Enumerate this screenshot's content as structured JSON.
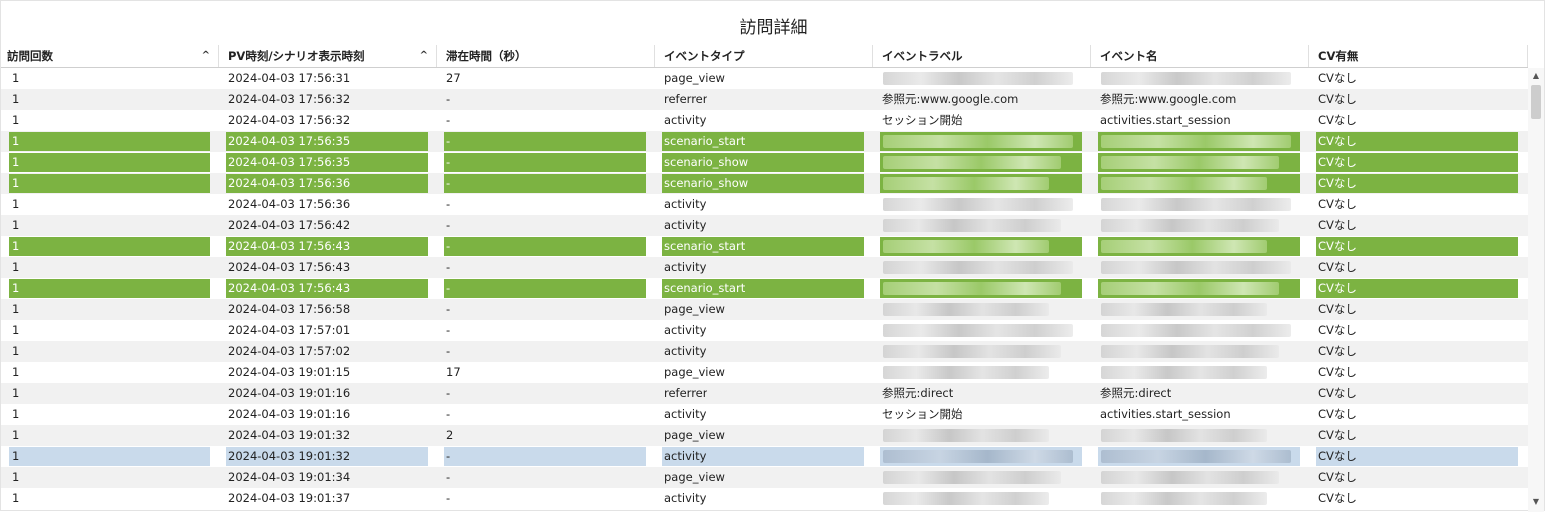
{
  "title": "訪問詳細",
  "columns": [
    {
      "label": "訪問回数",
      "sort": "^"
    },
    {
      "label": "PV時刻/シナリオ表示時刻",
      "sort": "^"
    },
    {
      "label": "滞在時間（秒）",
      "sort": ""
    },
    {
      "label": "イベントタイプ",
      "sort": ""
    },
    {
      "label": "イベントラベル",
      "sort": ""
    },
    {
      "label": "イベント名",
      "sort": ""
    },
    {
      "label": "CV有無",
      "sort": ""
    }
  ],
  "rows": [
    {
      "count": "1",
      "time": "2024-04-03 17:56:31",
      "stay": "27",
      "type": "page_view",
      "label": "",
      "name": "",
      "cv": "CVなし",
      "state": "normal"
    },
    {
      "count": "1",
      "time": "2024-04-03 17:56:32",
      "stay": "-",
      "type": "referrer",
      "label": "参照元:www.google.com",
      "name": "参照元:www.google.com",
      "cv": "CVなし",
      "state": "normal"
    },
    {
      "count": "1",
      "time": "2024-04-03 17:56:32",
      "stay": "-",
      "type": "activity",
      "label": "セッション開始",
      "name": "activities.start_session",
      "cv": "CVなし",
      "state": "normal"
    },
    {
      "count": "1",
      "time": "2024-04-03 17:56:35",
      "stay": "-",
      "type": "scenario_start",
      "label": "",
      "name": "",
      "cv": "CVなし",
      "state": "green"
    },
    {
      "count": "1",
      "time": "2024-04-03 17:56:35",
      "stay": "-",
      "type": "scenario_show",
      "label": "",
      "name": "",
      "cv": "CVなし",
      "state": "green"
    },
    {
      "count": "1",
      "time": "2024-04-03 17:56:36",
      "stay": "-",
      "type": "scenario_show",
      "label": "",
      "name": "",
      "cv": "CVなし",
      "state": "green"
    },
    {
      "count": "1",
      "time": "2024-04-03 17:56:36",
      "stay": "-",
      "type": "activity",
      "label": "",
      "name": "",
      "cv": "CVなし",
      "state": "normal"
    },
    {
      "count": "1",
      "time": "2024-04-03 17:56:42",
      "stay": "-",
      "type": "activity",
      "label": "",
      "name": "",
      "cv": "CVなし",
      "state": "normal"
    },
    {
      "count": "1",
      "time": "2024-04-03 17:56:43",
      "stay": "-",
      "type": "scenario_start",
      "label": "",
      "name": "",
      "cv": "CVなし",
      "state": "green"
    },
    {
      "count": "1",
      "time": "2024-04-03 17:56:43",
      "stay": "-",
      "type": "activity",
      "label": "",
      "name": "",
      "cv": "CVなし",
      "state": "normal"
    },
    {
      "count": "1",
      "time": "2024-04-03 17:56:43",
      "stay": "-",
      "type": "scenario_start",
      "label": "",
      "name": "",
      "cv": "CVなし",
      "state": "green"
    },
    {
      "count": "1",
      "time": "2024-04-03 17:56:58",
      "stay": "-",
      "type": "page_view",
      "label": "",
      "name": "",
      "cv": "CVなし",
      "state": "normal"
    },
    {
      "count": "1",
      "time": "2024-04-03 17:57:01",
      "stay": "-",
      "type": "activity",
      "label": "",
      "name": "",
      "cv": "CVなし",
      "state": "normal"
    },
    {
      "count": "1",
      "time": "2024-04-03 17:57:02",
      "stay": "-",
      "type": "activity",
      "label": "",
      "name": "",
      "cv": "CVなし",
      "state": "normal"
    },
    {
      "count": "1",
      "time": "2024-04-03 19:01:15",
      "stay": "17",
      "type": "page_view",
      "label": "",
      "name": "",
      "cv": "CVなし",
      "state": "normal"
    },
    {
      "count": "1",
      "time": "2024-04-03 19:01:16",
      "stay": "-",
      "type": "referrer",
      "label": "参照元:direct",
      "name": "参照元:direct",
      "cv": "CVなし",
      "state": "normal"
    },
    {
      "count": "1",
      "time": "2024-04-03 19:01:16",
      "stay": "-",
      "type": "activity",
      "label": "セッション開始",
      "name": "activities.start_session",
      "cv": "CVなし",
      "state": "normal"
    },
    {
      "count": "1",
      "time": "2024-04-03 19:01:32",
      "stay": "2",
      "type": "page_view",
      "label": "",
      "name": "",
      "cv": "CVなし",
      "state": "normal"
    },
    {
      "count": "1",
      "time": "2024-04-03 19:01:32",
      "stay": "-",
      "type": "activity",
      "label": "",
      "name": "",
      "cv": "CVなし",
      "state": "selected"
    },
    {
      "count": "1",
      "time": "2024-04-03 19:01:34",
      "stay": "-",
      "type": "page_view",
      "label": "",
      "name": "",
      "cv": "CVなし",
      "state": "normal"
    },
    {
      "count": "1",
      "time": "2024-04-03 19:01:37",
      "stay": "-",
      "type": "activity",
      "label": "",
      "name": "",
      "cv": "CVなし",
      "state": "normal"
    }
  ],
  "colors": {
    "highlight": "#7cb342",
    "selected": "#c9daeb",
    "alt_row": "#f1f1f1"
  },
  "icons": {
    "sort": "sort-asc-icon",
    "scroll_up": "scroll-up-icon",
    "scroll_down": "scroll-down-icon"
  }
}
